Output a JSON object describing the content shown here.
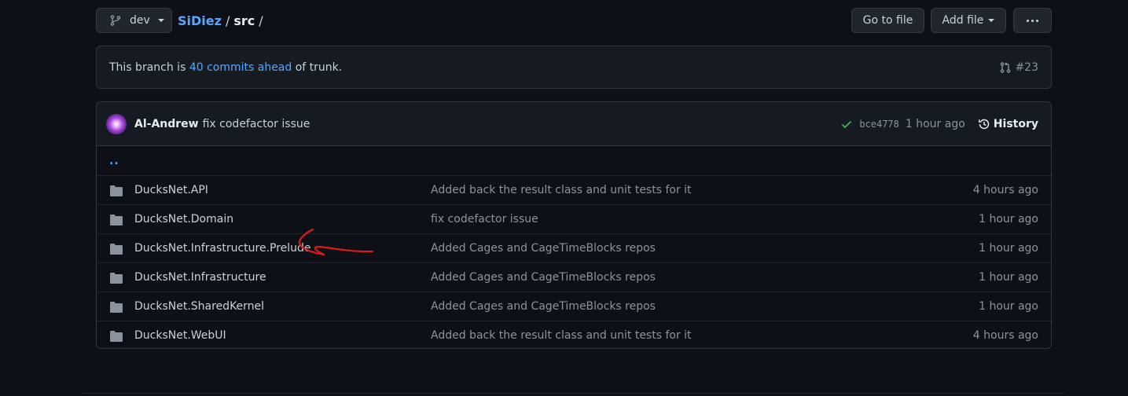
{
  "top": {
    "branch": "dev",
    "repo": "SiDiez",
    "sep1": "/",
    "dir": "src",
    "sep2": "/",
    "go_to_file": "Go to file",
    "add_file": "Add file"
  },
  "branch_info": {
    "prefix": "This branch is ",
    "link": "40 commits ahead",
    "suffix": " of trunk.",
    "pr": "#23"
  },
  "commit": {
    "author": "Al-Andrew",
    "message": "fix codefactor issue",
    "sha": "bce4778",
    "ago": "1 hour ago",
    "history": "History"
  },
  "parent_dir": "..",
  "files": [
    {
      "name": "DucksNet.API",
      "message": "Added back the result class and unit tests for it",
      "time": "4 hours ago"
    },
    {
      "name": "DucksNet.Domain",
      "message": "fix codefactor issue",
      "time": "1 hour ago"
    },
    {
      "name": "DucksNet.Infrastructure.Prelude",
      "message": "Added Cages and CageTimeBlocks repos",
      "time": "1 hour ago"
    },
    {
      "name": "DucksNet.Infrastructure",
      "message": "Added Cages and CageTimeBlocks repos",
      "time": "1 hour ago"
    },
    {
      "name": "DucksNet.SharedKernel",
      "message": "Added Cages and CageTimeBlocks repos",
      "time": "1 hour ago"
    },
    {
      "name": "DucksNet.WebUI",
      "message": "Added back the result class and unit tests for it",
      "time": "4 hours ago"
    }
  ],
  "icons": {
    "branch": "git-branch-icon",
    "pr": "pull-request-icon",
    "check": "check-icon",
    "history": "history-icon",
    "folder": "folder-icon",
    "more": "kebab-horizontal-icon"
  },
  "colors": {
    "background": "#0d1117",
    "link": "#58a6ff",
    "success": "#3fb950",
    "annotation": "#e0191b"
  }
}
